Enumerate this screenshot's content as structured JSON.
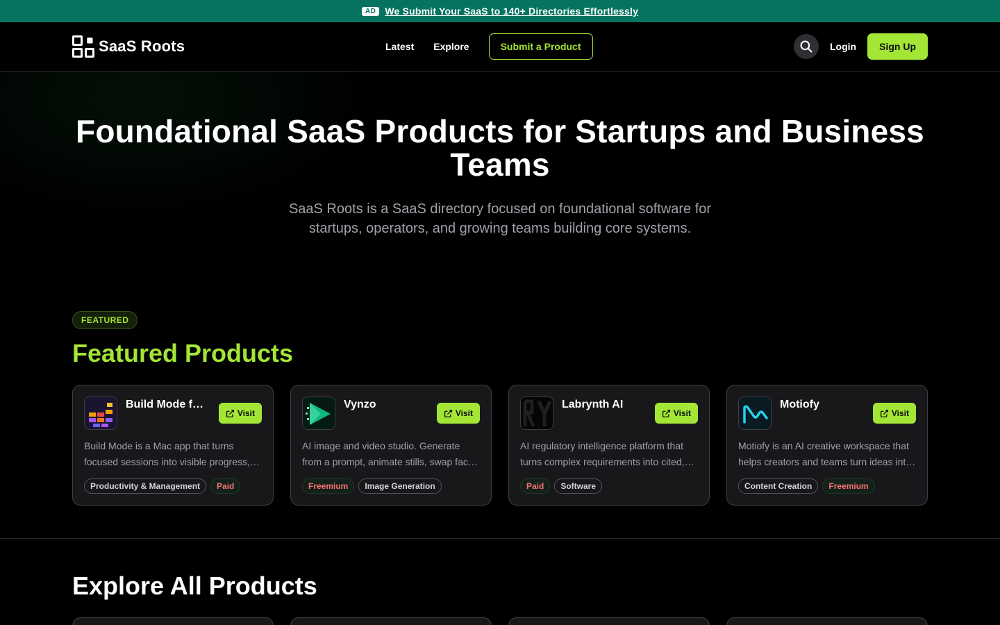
{
  "ad": {
    "badge": "AD",
    "text": "We Submit Your SaaS to 140+ Directories Effortlessly"
  },
  "header": {
    "logo_text": "SaaS Roots",
    "nav": {
      "latest": "Latest",
      "explore": "Explore",
      "submit": "Submit a Product"
    },
    "login": "Login",
    "signup": "Sign Up"
  },
  "hero": {
    "title": "Foundational SaaS Products for Startups and Business Teams",
    "subtitle": "SaaS Roots is a SaaS directory focused on foundational software for startups, operators, and growing teams building core systems."
  },
  "featured": {
    "badge": "FEATURED",
    "title": "Featured Products",
    "visit_label": "Visit",
    "cards": [
      {
        "name": "Build Mode f…",
        "desc": "Build Mode is a Mac app that turns focused sessions into visible progress, building a city block by block.",
        "tags": [
          {
            "label": "Productivity & Management",
            "style": "neutral"
          },
          {
            "label": "Paid",
            "style": "red"
          }
        ]
      },
      {
        "name": "Vynzo",
        "desc": "AI image and video studio. Generate from a prompt, animate stills, swap faces and more.",
        "tags": [
          {
            "label": "Freemium",
            "style": "red"
          },
          {
            "label": "Image Generation",
            "style": "neutral"
          }
        ]
      },
      {
        "name": "Labrynth AI",
        "desc": "AI regulatory intelligence platform that turns complex requirements into cited, actionable answers.",
        "tags": [
          {
            "label": "Paid",
            "style": "red"
          },
          {
            "label": "Software",
            "style": "neutral"
          }
        ]
      },
      {
        "name": "Motiofy",
        "desc": "Motiofy is an AI creative workspace that helps creators and teams turn ideas into motion videos.",
        "tags": [
          {
            "label": "Content Creation",
            "style": "neutral"
          },
          {
            "label": "Freemium",
            "style": "red"
          }
        ]
      }
    ]
  },
  "explore": {
    "title": "Explore All Products"
  },
  "colors": {
    "accent": "#a3e635",
    "banner": "#047461",
    "tag_red": "#f87171"
  }
}
